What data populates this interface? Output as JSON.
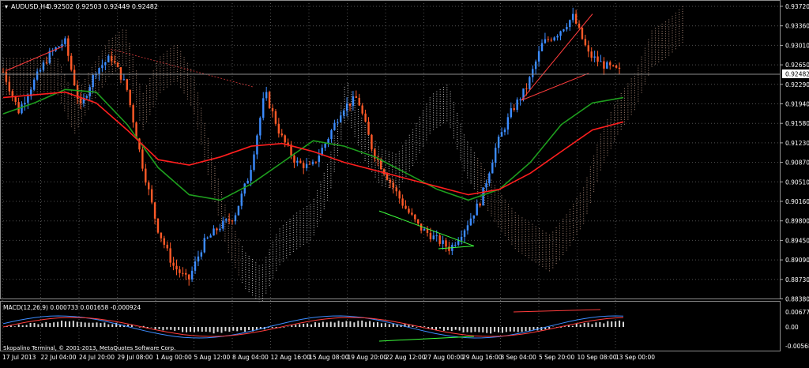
{
  "header": {
    "symbol_label": "AUDUSD,H4",
    "ohlc": "0.92502 0.92503 0.92449 0.92482"
  },
  "current_price": "0.92482",
  "price_axis": [
    "0.93720",
    "0.93360",
    "0.93010",
    "0.92650",
    "0.92290",
    "0.91940",
    "0.91580",
    "0.91230",
    "0.90870",
    "0.90510",
    "0.90160",
    "0.89800",
    "0.89450",
    "0.89090",
    "0.88730",
    "0.88380"
  ],
  "macd": {
    "label": "MACD(12,26,9) 0.000733 0.001658 -0.000924",
    "axis": [
      "0.00677",
      "0.00",
      "-0.00568"
    ]
  },
  "copyright": "Skopalino Terminal, © 2001-2013, MetaQuotes Software Corp.",
  "time_axis": [
    "17 Jul 2013",
    "22 Jul 04:00",
    "24 Jul 20:00",
    "29 Jul 08:00",
    "1 Aug 00:00",
    "5 Aug 12:00",
    "8 Aug 04:00",
    "12 Aug 16:00",
    "15 Aug 08:00",
    "19 Aug 20:00",
    "22 Aug 12:00",
    "27 Aug 00:00",
    "29 Aug 16:00",
    "3 Sep 04:00",
    "5 Sep 20:00",
    "10 Sep 08:00",
    "13 Sep 00:00"
  ],
  "colors": {
    "background": "#000000",
    "grid": "#505050",
    "bull": "#3c8cff",
    "bear": "#ff5a28",
    "ema_fast": "#1e9e1e",
    "ema_slow": "#ff1e1e",
    "cloud_bull": "#c8a08c",
    "cloud_bear": "#e0e0e0",
    "text": "#ffffff"
  },
  "chart_data": {
    "type": "candlestick",
    "y_range": [
      0.8838,
      0.9372
    ],
    "price_path": [
      0.9248,
      0.9175,
      0.923,
      0.928,
      0.9305,
      0.918,
      0.925,
      0.9275,
      0.922,
      0.908,
      0.896,
      0.889,
      0.886,
      0.893,
      0.896,
      0.898,
      0.906,
      0.921,
      0.913,
      0.908,
      0.907,
      0.912,
      0.918,
      0.92,
      0.91,
      0.905,
      0.9,
      0.896,
      0.894,
      0.892,
      0.896,
      0.901,
      0.911,
      0.9175,
      0.922,
      0.93,
      0.932,
      0.935,
      0.928,
      0.926,
      0.9248
    ],
    "ema_fast_path": [
      0.917,
      0.919,
      0.9215,
      0.921,
      0.915,
      0.907,
      0.902,
      0.901,
      0.904,
      0.908,
      0.912,
      0.911,
      0.909,
      0.906,
      0.903,
      0.901,
      0.903,
      0.908,
      0.915,
      0.919,
      0.92
    ],
    "ema_slow_path": [
      0.92,
      0.9205,
      0.921,
      0.919,
      0.914,
      0.9085,
      0.9075,
      0.909,
      0.911,
      0.9115,
      0.91,
      0.908,
      0.9065,
      0.905,
      0.9035,
      0.902,
      0.903,
      0.906,
      0.91,
      0.914,
      0.9155
    ]
  }
}
